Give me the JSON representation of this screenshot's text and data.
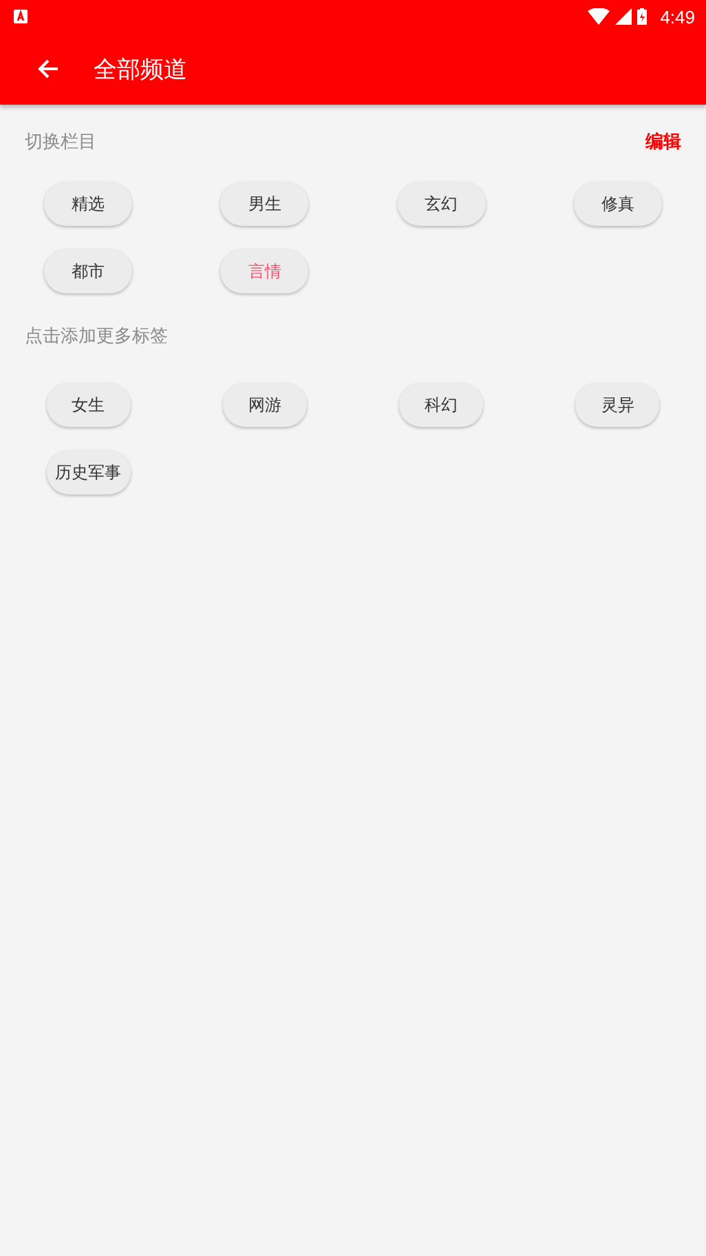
{
  "status_bar": {
    "time": "4:49"
  },
  "toolbar": {
    "title": "全部频道"
  },
  "my_channels": {
    "label": "切换栏目",
    "action": "编辑",
    "items": [
      {
        "label": "精选",
        "selected": false
      },
      {
        "label": "男生",
        "selected": false
      },
      {
        "label": "玄幻",
        "selected": false
      },
      {
        "label": "修真",
        "selected": false
      },
      {
        "label": "都市",
        "selected": false
      },
      {
        "label": "言情",
        "selected": true
      }
    ]
  },
  "more_channels": {
    "label": "点击添加更多标签",
    "items": [
      {
        "label": "女生"
      },
      {
        "label": "网游"
      },
      {
        "label": "科幻"
      },
      {
        "label": "灵异"
      },
      {
        "label": "历史军事"
      }
    ]
  }
}
